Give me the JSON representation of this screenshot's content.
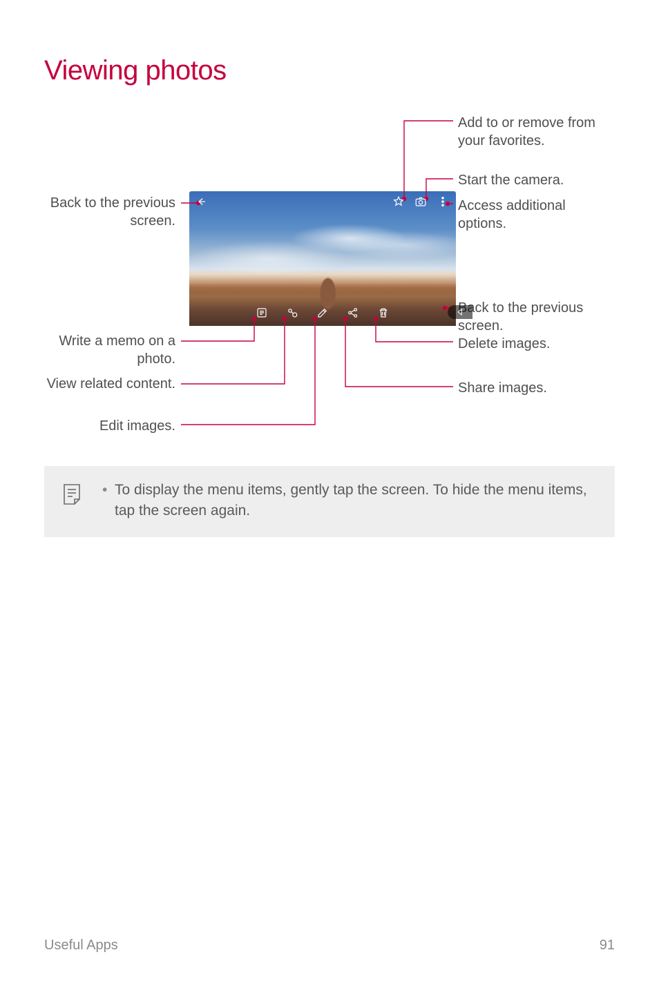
{
  "title": "Viewing photos",
  "labels": {
    "back_prev_left": "Back to the previous screen.",
    "write_memo": "Write a memo on a photo.",
    "view_related": "View related content.",
    "edit_images": "Edit images.",
    "fav": "Add to or remove from your favorites.",
    "start_camera": "Start the camera.",
    "access_options": "Access additional options.",
    "back_prev_right": "Back to the previous screen.",
    "delete": "Delete images.",
    "share": "Share images."
  },
  "note": {
    "text": "To display the menu items, gently tap the screen. To hide the menu items, tap the screen again."
  },
  "footer": {
    "section": "Useful Apps",
    "page": "91"
  }
}
